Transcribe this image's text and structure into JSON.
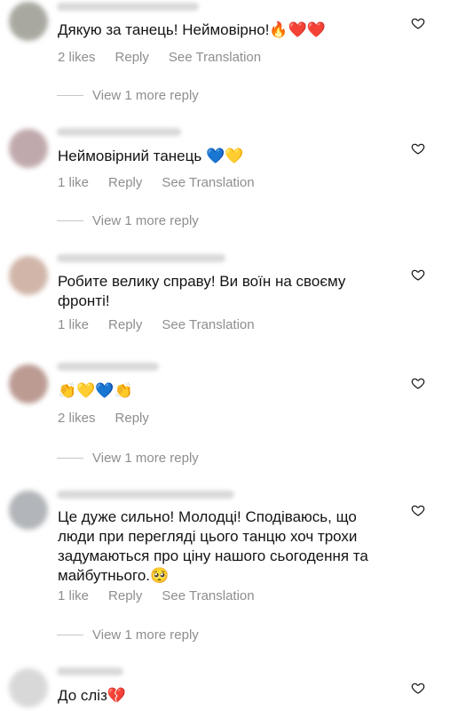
{
  "comments": [
    {
      "text": "Дякую за танець! Неймовірно!🔥❤️❤️",
      "likes": "2 likes",
      "reply": "Reply",
      "translate": "See Translation",
      "view_more": "View 1 more reply",
      "avatar_color": "#9a9a90"
    },
    {
      "text": "Неймовірний танець 💙💛",
      "likes": "1 like",
      "reply": "Reply",
      "translate": "See Translation",
      "view_more": "View 1 more reply",
      "avatar_color": "#b69b9e"
    },
    {
      "text": "Робите велику справу! Ви воїн на своєму фронті!",
      "likes": "1 like",
      "reply": "Reply",
      "translate": "See Translation",
      "avatar_color": "#c9a99a"
    },
    {
      "text": "👏💛💙👏",
      "likes": "2 likes",
      "reply": "Reply",
      "view_more": "View 1 more reply",
      "avatar_color": "#b08a80"
    },
    {
      "text": "Це дуже сильно! Молодці! Сподіваюсь, що люди при перегляді цього танцю хоч трохи задумаються про ціну нашого сьогодення та майбутнього.🥺",
      "likes": "1 like",
      "reply": "Reply",
      "translate": "See Translation",
      "view_more": "View 1 more reply",
      "avatar_color": "#a5a9ad"
    },
    {
      "text": "До сліз💔",
      "avatar_color": "#d2d2d2"
    }
  ],
  "colors": {
    "meta_text": "#8e8e8e",
    "main_text": "#141414",
    "background": "#ffffff"
  },
  "icons": {
    "like": "heart-outline-icon"
  }
}
